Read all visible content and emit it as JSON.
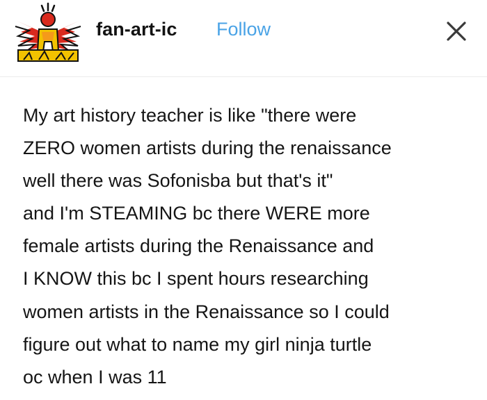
{
  "post": {
    "username": "fan-art-ic",
    "follow_label": "Follow",
    "close_icon": "close-icon",
    "avatar_icon": "fan-art-ic-avatar",
    "body_lines": [
      "My art history teacher is like \"there were",
      "ZERO women artists during the renaissance",
      "well there was Sofonisba but that's it\"",
      "and I'm STEAMING bc there WERE more",
      "female artists during the Renaissance and",
      "I KNOW this bc I spent hours researching",
      "women artists in the Renaissance so I could",
      "figure out what to name my girl ninja turtle",
      "oc when I was 11"
    ]
  },
  "colors": {
    "follow": "#4aa3e6",
    "text": "#151515",
    "avatar_bg": "#f2c200",
    "avatar_red": "#d92a1e"
  }
}
